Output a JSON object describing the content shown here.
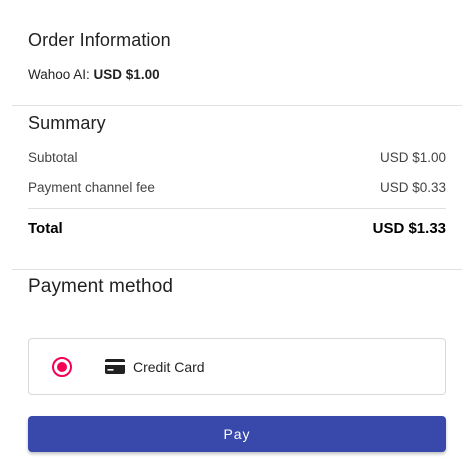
{
  "order": {
    "title": "Order Information",
    "item_label": "Wahoo AI: ",
    "item_amount": "USD $1.00"
  },
  "summary": {
    "title": "Summary",
    "subtotal_label": "Subtotal",
    "subtotal_value": "USD $1.00",
    "fee_label": "Payment channel fee",
    "fee_value": "USD $0.33",
    "total_label": "Total",
    "total_value": "USD $1.33"
  },
  "payment": {
    "title": "Payment method",
    "methods": [
      {
        "label": "Credit Card",
        "icon": "credit-card-icon",
        "selected": true
      }
    ],
    "pay_label": "Pay"
  },
  "colors": {
    "radio_accent": "#f50057",
    "pay_button": "#3949ab"
  }
}
